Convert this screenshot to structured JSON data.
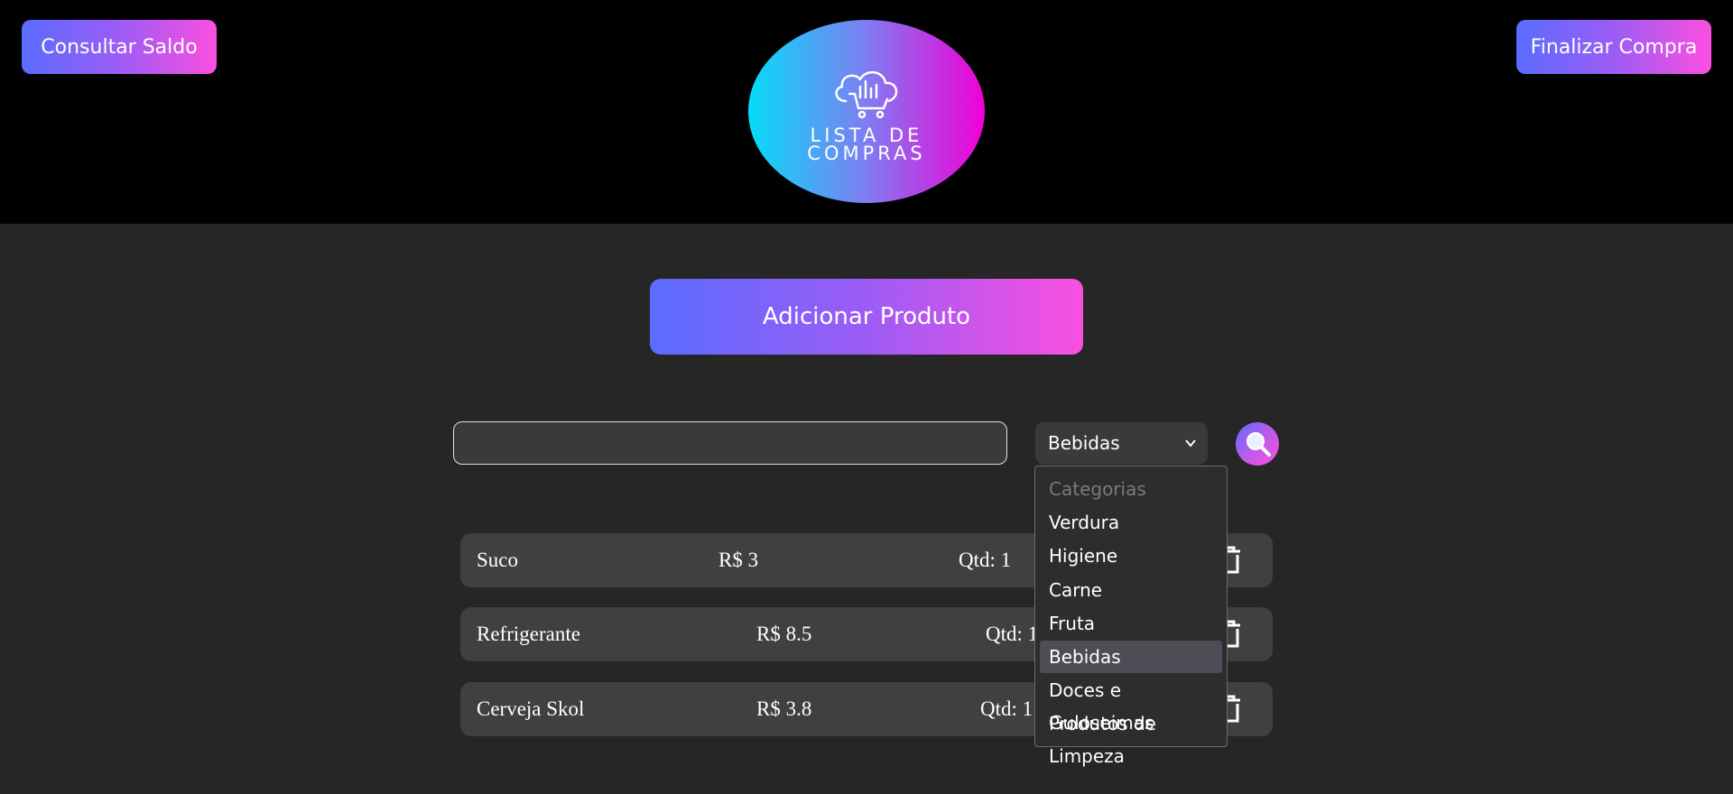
{
  "header": {
    "consult_balance_label": "Consultar Saldo",
    "finish_purchase_label": "Finalizar Compra",
    "logo_line1": "LISTA DE",
    "logo_line2": "COMPRAS"
  },
  "main": {
    "add_product_label": "Adicionar Produto",
    "search": {
      "value": "",
      "placeholder": ""
    },
    "category_select": {
      "selected": "Bebidas"
    },
    "category_dropdown": {
      "placeholder": "Categorias",
      "options": [
        "Verdura",
        "Higiene",
        "Carne",
        "Fruta",
        "Bebidas",
        "Doces e Guloseimas",
        "Produtos de Limpeza"
      ],
      "selected_index": 4
    },
    "products": [
      {
        "name": "Suco",
        "price": "R$ 3",
        "qty": "Qtd: 1"
      },
      {
        "name": "Refrigerante",
        "price": "R$ 8.5",
        "qty": "Qtd: 1"
      },
      {
        "name": "Cerveja Skol",
        "price": "R$ 3.8",
        "qty": "Qtd: 1"
      }
    ]
  },
  "icons": {
    "logo": "cloud-cart-icon",
    "search": "search-icon",
    "delete": "trash-icon",
    "select_arrow": "chevron-down-icon"
  },
  "colors": {
    "header_bg": "#000000",
    "page_bg": "#262626",
    "button_gradient": [
      "#5b6cff",
      "#fb4fe0"
    ],
    "logo_gradient": [
      "#05dcf8",
      "#f000d6"
    ],
    "row_bg": "#404040"
  }
}
